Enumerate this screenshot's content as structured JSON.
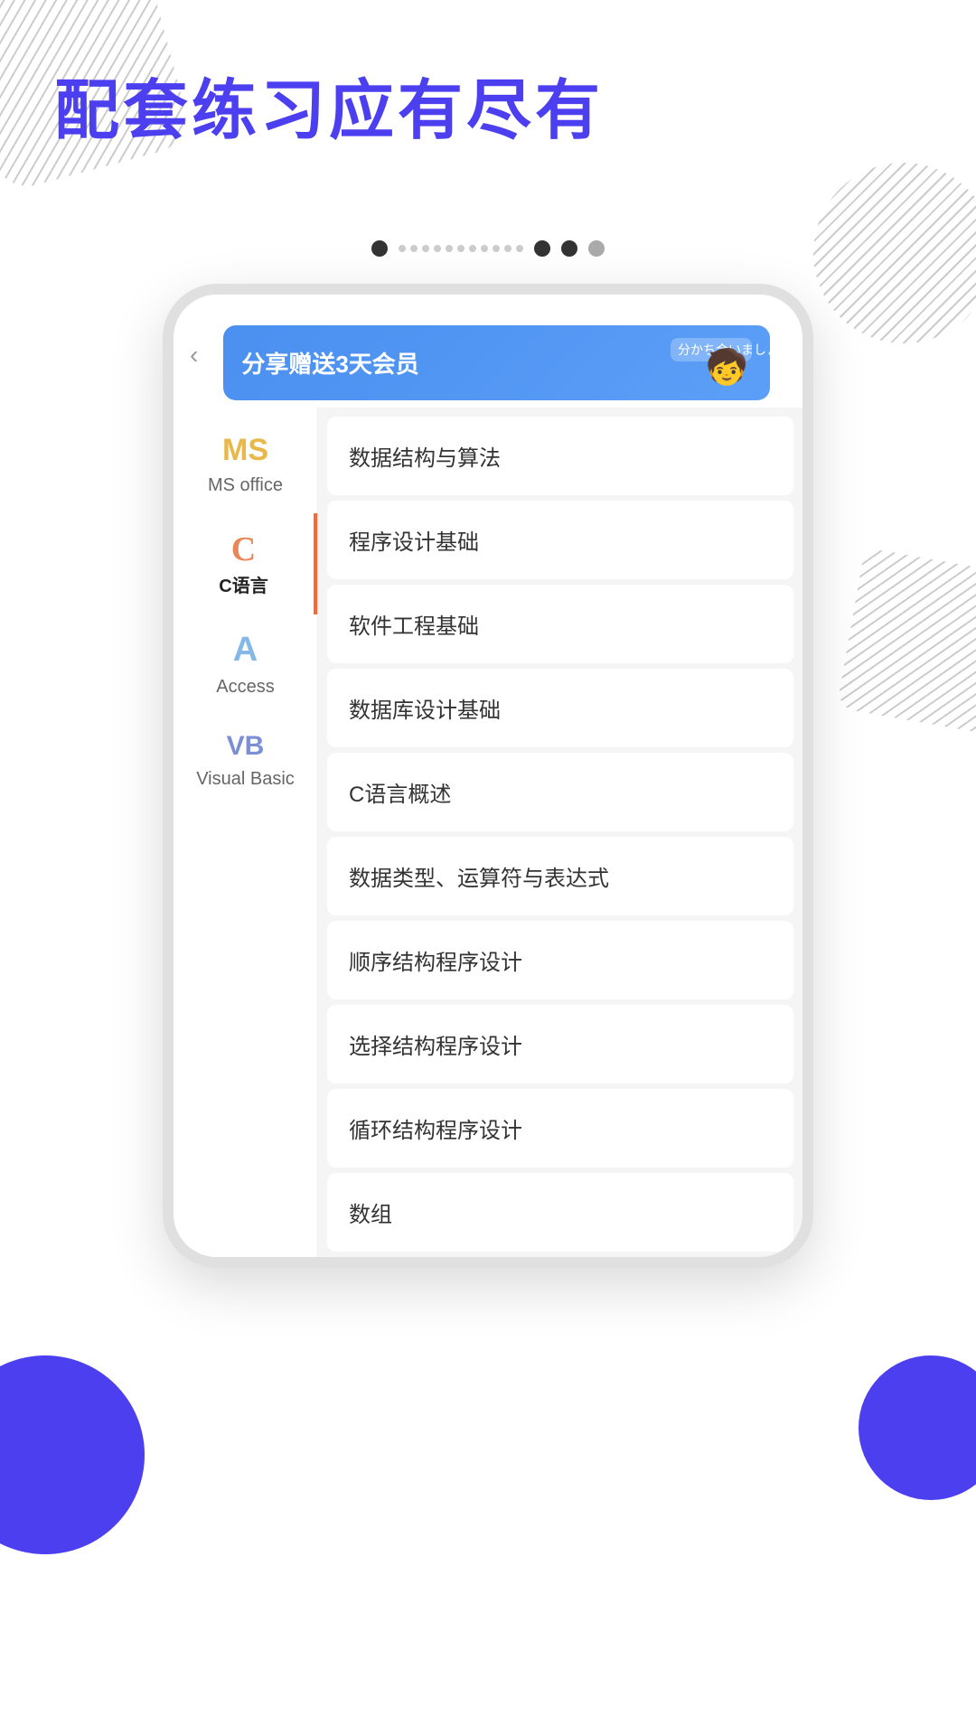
{
  "header": {
    "title": "配套练习应有尽有"
  },
  "pagination": {
    "dots": [
      "filled",
      "line",
      "filled",
      "filled",
      "empty"
    ]
  },
  "share_banner": {
    "text": "分享赠送3天会员",
    "mascot_text": "分かち合いましょう"
  },
  "sidebar": {
    "items": [
      {
        "id": "ms-office",
        "icon": "MS",
        "icon_color": "#E8B84B",
        "label": "MS office",
        "active": false
      },
      {
        "id": "c-language",
        "icon": "C",
        "icon_color": "#E8875A",
        "label": "C语言",
        "active": true
      },
      {
        "id": "access",
        "icon": "A",
        "icon_color": "#85B8E8",
        "label": "Access",
        "active": false
      },
      {
        "id": "visual-basic",
        "icon": "VB",
        "icon_color": "#7B8FD4",
        "label": "Visual Basic",
        "active": false
      }
    ]
  },
  "list_items": [
    "数据结构与算法",
    "程序设计基础",
    "软件工程基础",
    "数据库设计基础",
    "C语言概述",
    "数据类型、运算符与表达式",
    "顺序结构程序设计",
    "选择结构程序设计",
    "循环结构程序设计",
    "数组"
  ],
  "back_button": "‹",
  "colors": {
    "accent_blue": "#4B3FF0",
    "accent_orange": "#FF6633",
    "ms_color": "#E8B84B",
    "c_color": "#E8875A",
    "access_color": "#85B8E8",
    "vb_color": "#7B8FD4"
  }
}
